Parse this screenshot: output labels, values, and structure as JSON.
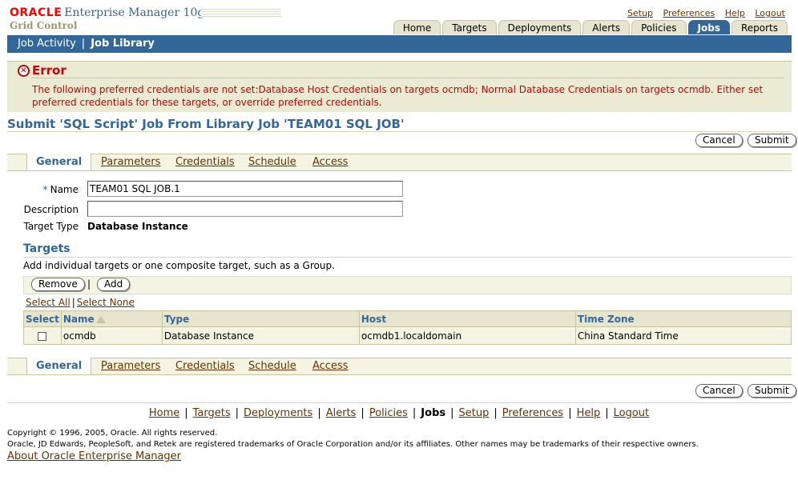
{
  "header": {
    "oracle": "ORACLE",
    "product": "Enterprise Manager 10g",
    "subtitle": "Grid Control",
    "global_links": [
      "Setup",
      "Preferences",
      "Help",
      "Logout"
    ],
    "tabs": [
      "Home",
      "Targets",
      "Deployments",
      "Alerts",
      "Policies",
      "Jobs",
      "Reports"
    ],
    "active_tab": "Jobs"
  },
  "subnav": {
    "items": [
      "Job Activity",
      "Job Library"
    ],
    "separator": "|",
    "active": "Job Library"
  },
  "error": {
    "title": "Error",
    "message": "The following preferred credentials are not set:Database Host Credentials on targets ocmdb; Normal Database Credentials on targets ocmdb. Either set preferred credentials for these targets, or override preferred credentials."
  },
  "page_title": "Submit 'SQL Script' Job From Library Job 'TEAM01 SQL JOB'",
  "buttons": {
    "cancel": "Cancel",
    "submit": "Submit",
    "remove": "Remove",
    "add": "Add"
  },
  "subtabs": [
    "General",
    "Parameters",
    "Credentials",
    "Schedule",
    "Access"
  ],
  "form": {
    "required_marker": "*",
    "name_label": "Name",
    "name_value": "TEAM01 SQL JOB.1",
    "description_label": "Description",
    "description_value": "",
    "target_type_label": "Target Type",
    "target_type_value": "Database Instance"
  },
  "targets": {
    "title": "Targets",
    "instruction": "Add individual targets or one composite target, such as a Group.",
    "select_all": "Select All",
    "select_none": "Select None",
    "columns": [
      "Select",
      "Name",
      "Type",
      "Host",
      "Time Zone"
    ],
    "rows": [
      {
        "name": "ocmdb",
        "type": "Database Instance",
        "host": "ocmdb1.localdomain",
        "timezone": "China Standard Time"
      }
    ]
  },
  "footer": {
    "links": [
      "Home",
      "Targets",
      "Deployments",
      "Alerts",
      "Policies",
      "Jobs",
      "Setup",
      "Preferences",
      "Help",
      "Logout"
    ],
    "current": "Jobs",
    "copyright": "Copyright © 1996, 2005, Oracle. All rights reserved.",
    "trademark": "Oracle, JD Edwards, PeopleSoft, and Retek are registered trademarks of Oracle Corporation and/or its affiliates. Other names may be trademarks of their respective owners.",
    "about": "About Oracle Enterprise Manager"
  }
}
